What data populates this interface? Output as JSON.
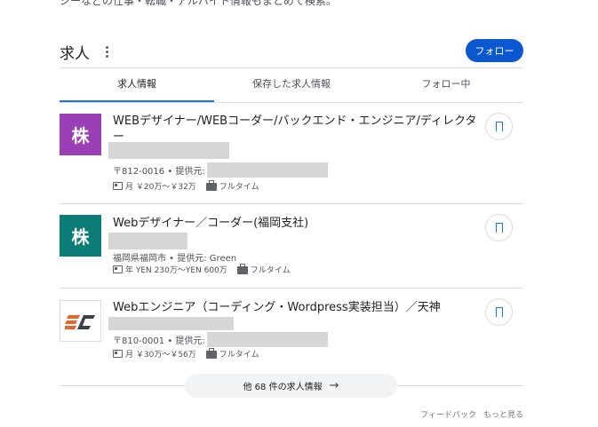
{
  "snippet": {
    "text": "ジーなどの仕事・転職・アルバイト情報もまとめて検索。"
  },
  "header": {
    "title": "求人",
    "follow_label": "フォロー"
  },
  "tabs": [
    {
      "label": "求人情報",
      "active": true
    },
    {
      "label": "保存した求人情報",
      "active": false
    },
    {
      "label": "フォロー中",
      "active": false
    }
  ],
  "jobs": [
    {
      "logo_text": "株",
      "title": "WEBデザイナー/WEBコーダー/バックエンド・エンジニア/ディレクター",
      "location_line": "〒812-0016 • 提供元:",
      "salary": "月 ￥20万～￥32万",
      "type": "フルタイム"
    },
    {
      "logo_text": "株",
      "title": "Webデザイナー／コーダー(福岡支社)",
      "location_line": "福岡県福岡市 • 提供元: Green",
      "salary": "年 YEN 230万～YEN 600万",
      "type": "フルタイム"
    },
    {
      "logo_text": "EC",
      "title": "Webエンジニア（コーディング・Wordpress実装担当）／天神",
      "location_line": "〒810-0001 • 提供元:",
      "salary": "月 ￥30万～￥56万",
      "type": "フルタイム"
    }
  ],
  "more_jobs": {
    "label": "他 68 件の求人情報",
    "arrow": "→"
  },
  "footer": {
    "feedback": "フィードバック",
    "see_more": "もっと見る"
  },
  "colors": {
    "accent": "#0b57d0",
    "tab_indicator": "#1a73e8",
    "logo_purple": "#9b3fb7",
    "logo_teal": "#0b7d76",
    "ec_orange": "#e8622a",
    "ec_dark": "#3c4043"
  }
}
